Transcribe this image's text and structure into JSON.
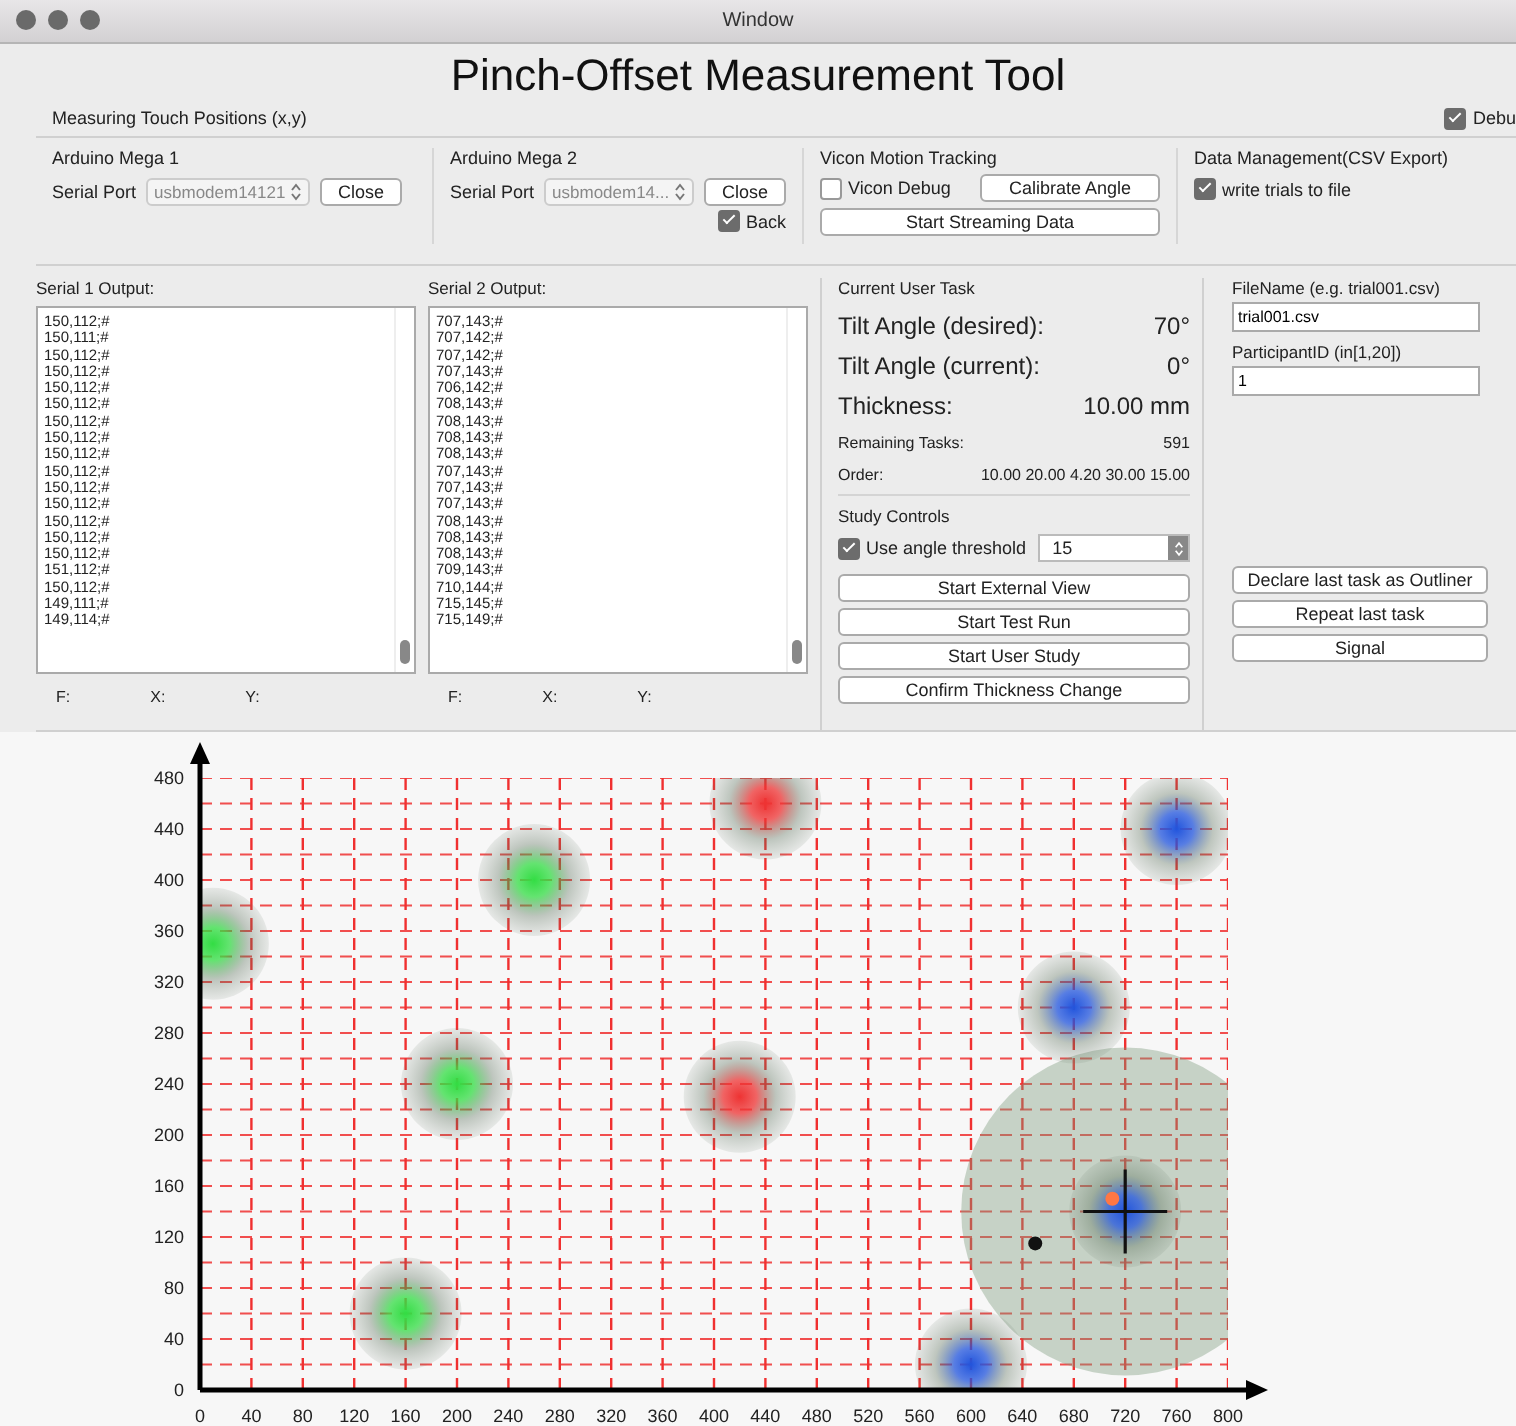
{
  "window": {
    "title": "Window"
  },
  "app_title": "Pinch-Offset Measurement Tool",
  "header_label": "Measuring Touch Positions (x,y)",
  "debug_checkbox": {
    "label": "Debu",
    "checked": true
  },
  "arduino_groups": [
    {
      "title": "Arduino Mega 1",
      "port_label": "Serial Port",
      "port_value": "usbmodem14121",
      "button": "Close"
    },
    {
      "title": "Arduino Mega 2",
      "port_label": "Serial Port",
      "port_value": "usbmodem14...",
      "button": "Close",
      "back": {
        "label": "Back",
        "checked": true
      }
    }
  ],
  "vicon": {
    "title": "Vicon Motion Tracking",
    "debug": {
      "label": "Vicon Debug",
      "checked": false
    },
    "calibrate_button": "Calibrate Angle",
    "stream_button": "Start Streaming Data"
  },
  "data_management": {
    "title": "Data Management(CSV Export)",
    "write_trials": {
      "label": "write trials to file",
      "checked": true
    }
  },
  "serial_outputs": [
    {
      "title": "Serial 1 Output:",
      "lines": [
        "150,112;#",
        "150,111;#",
        "150,112;#",
        "150,112;#",
        "150,112;#",
        "150,112;#",
        "150,112;#",
        "150,112;#",
        "150,112;#",
        "150,112;#",
        "150,112;#",
        "150,112;#",
        "150,112;#",
        "150,112;#",
        "150,112;#",
        "151,112;#",
        "150,112;#",
        "149,111;#",
        "149,114;#"
      ],
      "fields": [
        "F:",
        "X:",
        "Y:"
      ]
    },
    {
      "title": "Serial 2 Output:",
      "lines": [
        "707,143;#",
        "707,142;#",
        "707,142;#",
        "707,143;#",
        "706,142;#",
        "708,143;#",
        "708,143;#",
        "708,143;#",
        "708,143;#",
        "707,143;#",
        "707,143;#",
        "707,143;#",
        "708,143;#",
        "708,143;#",
        "708,143;#",
        "709,143;#",
        "710,144;#",
        "715,145;#",
        "715,149;#"
      ],
      "fields": [
        "F:",
        "X:",
        "Y:"
      ]
    }
  ],
  "current_task": {
    "title": "Current User Task",
    "rows": [
      {
        "kind": "large",
        "label": "Tilt Angle (desired):",
        "value": "70°"
      },
      {
        "kind": "large",
        "label": "Tilt Angle (current):",
        "value": "0°"
      },
      {
        "kind": "large",
        "label": "Thickness:",
        "value": "10.00 mm"
      },
      {
        "kind": "small",
        "label": "Remaining Tasks:",
        "value": "591"
      },
      {
        "kind": "small",
        "label": "Order:",
        "value": "10.00 20.00 4.20 30.00 15.00"
      }
    ]
  },
  "study_controls": {
    "title": "Study Controls",
    "threshold": {
      "label": "Use angle threshold",
      "checked": true,
      "value": "15"
    },
    "buttons": [
      "Start External View",
      "Start Test Run",
      "Start User Study",
      "Confirm Thickness Change"
    ]
  },
  "file_fields": [
    {
      "label": "FileName (e.g. trial001.csv)",
      "value": "trial001.csv"
    },
    {
      "label": "ParticipantID (in[1,20])",
      "value": "1"
    }
  ],
  "side_buttons": [
    "Declare last task as Outliner",
    "Repeat last task",
    "Signal"
  ],
  "chart_data": {
    "type": "scatter",
    "grid": true,
    "xlim": [
      0,
      800
    ],
    "ylim": [
      0,
      480
    ],
    "xticks": [
      0,
      40,
      80,
      120,
      160,
      200,
      240,
      280,
      320,
      360,
      400,
      440,
      480,
      520,
      560,
      600,
      640,
      680,
      720,
      760,
      800
    ],
    "yticks": [
      0,
      40,
      80,
      120,
      160,
      200,
      240,
      280,
      320,
      360,
      400,
      440,
      480
    ],
    "series": [
      {
        "color": "#33dd44",
        "x": [
          10,
          260,
          200,
          160
        ],
        "values": [
          350,
          400,
          240,
          60
        ]
      },
      {
        "color": "#ee3333",
        "x": [
          440,
          420
        ],
        "values": [
          460,
          230
        ]
      },
      {
        "color": "#2255dd",
        "x": [
          760,
          680,
          720,
          600
        ],
        "values": [
          440,
          300,
          140,
          20
        ]
      },
      {
        "color": "#111111",
        "x": [
          650
        ],
        "values": [
          115
        ]
      },
      {
        "color": "#ff7744",
        "x": [
          710
        ],
        "values": [
          150
        ]
      }
    ]
  }
}
